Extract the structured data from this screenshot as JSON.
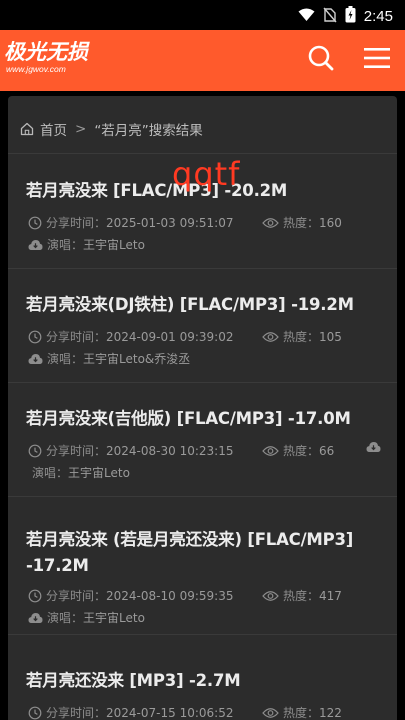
{
  "status": {
    "time": "2:45"
  },
  "header": {
    "logo_main": "极光无损",
    "logo_sub": "www.jgwov.com"
  },
  "breadcrumb": {
    "home": "首页",
    "separator": ">",
    "current": "“若月亮”搜索结果"
  },
  "watermark": "qqtf",
  "labels": {
    "share_time": "分享时间：",
    "heat": "热度：",
    "singer": "演唱："
  },
  "results": [
    {
      "title": "若月亮没来 [FLAC/MP3] -20.2M",
      "share_time": "2025-01-03 09:51:07",
      "heat": "160",
      "singer": "王宇宙Leto"
    },
    {
      "title": "若月亮没来(DJ铁柱) [FLAC/MP3] -19.2M",
      "share_time": "2024-09-01 09:39:02",
      "heat": "105",
      "singer": "王宇宙Leto&乔浚丞"
    },
    {
      "title": "若月亮没来(吉他版) [FLAC/MP3] -17.0M",
      "share_time": "2024-08-30 10:23:15",
      "heat": "66",
      "singer": "王宇宙Leto"
    },
    {
      "title": "若月亮没来 (若是月亮还没来) [FLAC/MP3] -17.2M",
      "share_time": "2024-08-10 09:59:35",
      "heat": "417",
      "singer": "王宇宙Leto"
    },
    {
      "title": "若月亮还没来 [MP3] -2.7M",
      "share_time": "2024-07-15 10:06:52",
      "heat": "122",
      "singer": ""
    }
  ],
  "colors": {
    "header_bg": "#ff5a2c",
    "panel_bg": "#2c2c2c",
    "watermark": "#ff3a22"
  }
}
